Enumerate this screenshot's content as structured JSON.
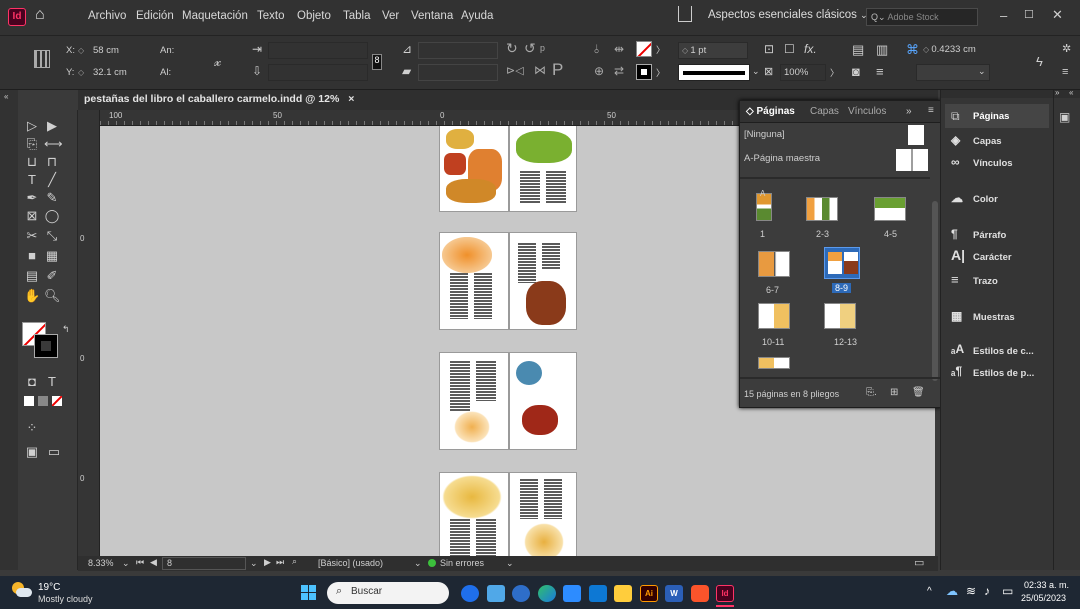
{
  "app": {
    "logo": "Id",
    "home_icon": "home-icon",
    "share_icon": "share-icon"
  },
  "menu": [
    "Archivo",
    "Edición",
    "Maquetación",
    "Texto",
    "Objeto",
    "Tabla",
    "Ver",
    "Ventana",
    "Ayuda"
  ],
  "workspace": {
    "label": "Aspectos esenciales clásicos",
    "search_placeholder": "Adobe Stock"
  },
  "window_controls": {
    "minimize": "–",
    "maximize": "☐",
    "close": "✕"
  },
  "control": {
    "x_label": "X:",
    "x_value": "58 cm",
    "y_label": "Y:",
    "y_value": "32.1 cm",
    "w_label": "An:",
    "w_value": "",
    "h_label": "Al:",
    "h_value": "",
    "stroke_weight": "1 pt",
    "zoom_pct": "100%",
    "offset_value": "0.4233 cm",
    "fx_label": "fx."
  },
  "document_tab": {
    "title": "pestañas del libro el caballero carmelo.indd @ 12%",
    "close": "×"
  },
  "ruler": {
    "top_labels": [
      "100",
      "50",
      "0",
      "50"
    ],
    "left_labels": [
      "0",
      "0",
      "0"
    ]
  },
  "status": {
    "zoom": "8.33%",
    "page": "8",
    "style": "[Básico] (usado)",
    "errors": "Sin errores"
  },
  "pages_panel": {
    "tabs": [
      "Páginas",
      "Capas",
      "Vínculos"
    ],
    "none_label": "[Ninguna]",
    "master_label": "A-Página maestra",
    "spreads": [
      "1",
      "2-3",
      "4-5",
      "6-7",
      "8-9",
      "10-11",
      "12-13"
    ],
    "selected_spread": "8-9",
    "summary": "15 páginas en 8 pliegos",
    "master_letter": "A"
  },
  "dock": {
    "items": [
      "Páginas",
      "Capas",
      "Vínculos",
      "Color",
      "Párrafo",
      "Carácter",
      "Trazo",
      "Muestras",
      "Estilos de c...",
      "Estilos de p..."
    ]
  },
  "taskbar": {
    "weather_temp": "19°C",
    "weather_desc": "Mostly cloudy",
    "search_placeholder": "Buscar",
    "time": "02:33 a. m.",
    "date": "25/05/2023"
  },
  "colors": {
    "accent": "#2d6ab8",
    "indesign": "#ff3366",
    "canvas": "#c8c8c8",
    "errors_ok": "#3cc03c"
  }
}
